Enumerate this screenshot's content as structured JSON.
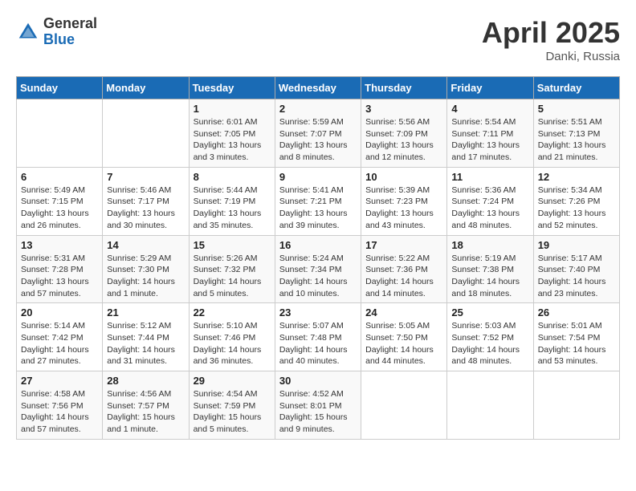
{
  "header": {
    "logo_general": "General",
    "logo_blue": "Blue",
    "month_title": "April 2025",
    "location": "Danki, Russia"
  },
  "days_of_week": [
    "Sunday",
    "Monday",
    "Tuesday",
    "Wednesday",
    "Thursday",
    "Friday",
    "Saturday"
  ],
  "weeks": [
    [
      {
        "day": "",
        "detail": ""
      },
      {
        "day": "",
        "detail": ""
      },
      {
        "day": "1",
        "detail": "Sunrise: 6:01 AM\nSunset: 7:05 PM\nDaylight: 13 hours\nand 3 minutes."
      },
      {
        "day": "2",
        "detail": "Sunrise: 5:59 AM\nSunset: 7:07 PM\nDaylight: 13 hours\nand 8 minutes."
      },
      {
        "day": "3",
        "detail": "Sunrise: 5:56 AM\nSunset: 7:09 PM\nDaylight: 13 hours\nand 12 minutes."
      },
      {
        "day": "4",
        "detail": "Sunrise: 5:54 AM\nSunset: 7:11 PM\nDaylight: 13 hours\nand 17 minutes."
      },
      {
        "day": "5",
        "detail": "Sunrise: 5:51 AM\nSunset: 7:13 PM\nDaylight: 13 hours\nand 21 minutes."
      }
    ],
    [
      {
        "day": "6",
        "detail": "Sunrise: 5:49 AM\nSunset: 7:15 PM\nDaylight: 13 hours\nand 26 minutes."
      },
      {
        "day": "7",
        "detail": "Sunrise: 5:46 AM\nSunset: 7:17 PM\nDaylight: 13 hours\nand 30 minutes."
      },
      {
        "day": "8",
        "detail": "Sunrise: 5:44 AM\nSunset: 7:19 PM\nDaylight: 13 hours\nand 35 minutes."
      },
      {
        "day": "9",
        "detail": "Sunrise: 5:41 AM\nSunset: 7:21 PM\nDaylight: 13 hours\nand 39 minutes."
      },
      {
        "day": "10",
        "detail": "Sunrise: 5:39 AM\nSunset: 7:23 PM\nDaylight: 13 hours\nand 43 minutes."
      },
      {
        "day": "11",
        "detail": "Sunrise: 5:36 AM\nSunset: 7:24 PM\nDaylight: 13 hours\nand 48 minutes."
      },
      {
        "day": "12",
        "detail": "Sunrise: 5:34 AM\nSunset: 7:26 PM\nDaylight: 13 hours\nand 52 minutes."
      }
    ],
    [
      {
        "day": "13",
        "detail": "Sunrise: 5:31 AM\nSunset: 7:28 PM\nDaylight: 13 hours\nand 57 minutes."
      },
      {
        "day": "14",
        "detail": "Sunrise: 5:29 AM\nSunset: 7:30 PM\nDaylight: 14 hours\nand 1 minute."
      },
      {
        "day": "15",
        "detail": "Sunrise: 5:26 AM\nSunset: 7:32 PM\nDaylight: 14 hours\nand 5 minutes."
      },
      {
        "day": "16",
        "detail": "Sunrise: 5:24 AM\nSunset: 7:34 PM\nDaylight: 14 hours\nand 10 minutes."
      },
      {
        "day": "17",
        "detail": "Sunrise: 5:22 AM\nSunset: 7:36 PM\nDaylight: 14 hours\nand 14 minutes."
      },
      {
        "day": "18",
        "detail": "Sunrise: 5:19 AM\nSunset: 7:38 PM\nDaylight: 14 hours\nand 18 minutes."
      },
      {
        "day": "19",
        "detail": "Sunrise: 5:17 AM\nSunset: 7:40 PM\nDaylight: 14 hours\nand 23 minutes."
      }
    ],
    [
      {
        "day": "20",
        "detail": "Sunrise: 5:14 AM\nSunset: 7:42 PM\nDaylight: 14 hours\nand 27 minutes."
      },
      {
        "day": "21",
        "detail": "Sunrise: 5:12 AM\nSunset: 7:44 PM\nDaylight: 14 hours\nand 31 minutes."
      },
      {
        "day": "22",
        "detail": "Sunrise: 5:10 AM\nSunset: 7:46 PM\nDaylight: 14 hours\nand 36 minutes."
      },
      {
        "day": "23",
        "detail": "Sunrise: 5:07 AM\nSunset: 7:48 PM\nDaylight: 14 hours\nand 40 minutes."
      },
      {
        "day": "24",
        "detail": "Sunrise: 5:05 AM\nSunset: 7:50 PM\nDaylight: 14 hours\nand 44 minutes."
      },
      {
        "day": "25",
        "detail": "Sunrise: 5:03 AM\nSunset: 7:52 PM\nDaylight: 14 hours\nand 48 minutes."
      },
      {
        "day": "26",
        "detail": "Sunrise: 5:01 AM\nSunset: 7:54 PM\nDaylight: 14 hours\nand 53 minutes."
      }
    ],
    [
      {
        "day": "27",
        "detail": "Sunrise: 4:58 AM\nSunset: 7:56 PM\nDaylight: 14 hours\nand 57 minutes."
      },
      {
        "day": "28",
        "detail": "Sunrise: 4:56 AM\nSunset: 7:57 PM\nDaylight: 15 hours\nand 1 minute."
      },
      {
        "day": "29",
        "detail": "Sunrise: 4:54 AM\nSunset: 7:59 PM\nDaylight: 15 hours\nand 5 minutes."
      },
      {
        "day": "30",
        "detail": "Sunrise: 4:52 AM\nSunset: 8:01 PM\nDaylight: 15 hours\nand 9 minutes."
      },
      {
        "day": "",
        "detail": ""
      },
      {
        "day": "",
        "detail": ""
      },
      {
        "day": "",
        "detail": ""
      }
    ]
  ]
}
